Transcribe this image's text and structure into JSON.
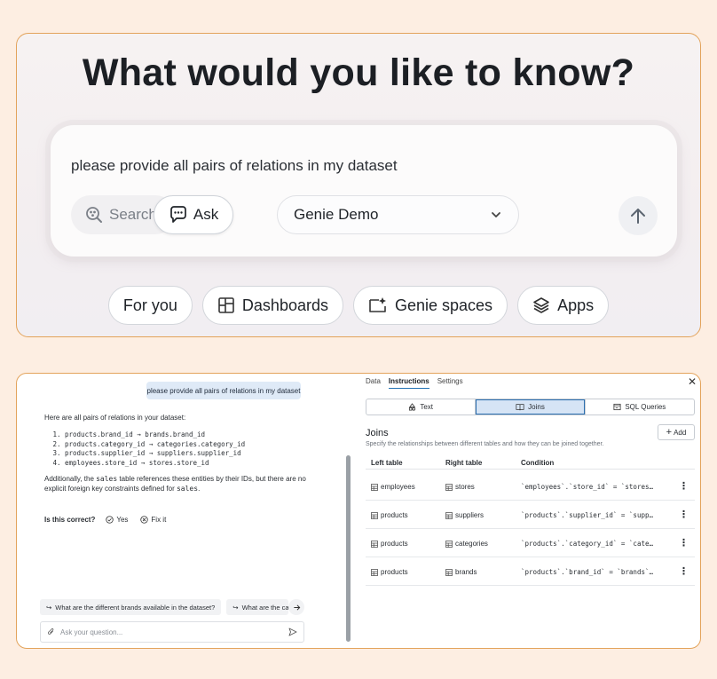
{
  "hero": {
    "title": "What would you like to know?"
  },
  "prompt": {
    "text": "please provide all pairs of relations in my dataset",
    "modes": {
      "search": "Search",
      "ask": "Ask"
    },
    "space_select": "Genie Demo"
  },
  "pills": [
    "For you",
    "Dashboards",
    "Genie spaces",
    "Apps"
  ],
  "chat": {
    "user_message": "please provide all pairs of relations in my dataset",
    "answer_intro": "Here are all pairs of relations in your dataset:",
    "relations": [
      "products.brand_id → brands.brand_id",
      "products.category_id → categories.category_id",
      "products.supplier_id → suppliers.supplier_id",
      "employees.store_id → stores.store_id"
    ],
    "answer_note_1": "Additionally, the ",
    "answer_note_code": "sales",
    "answer_note_2": " table references these entities by their IDs, but there are no explicit foreign key constraints defined for ",
    "answer_note_code2": "sales",
    "answer_note_3": ".",
    "feedback": {
      "label": "Is this correct?",
      "yes": "Yes",
      "fix": "Fix it"
    },
    "suggestions": [
      "What are the different brands available in the dataset?",
      "What are the categories"
    ],
    "input_placeholder": "Ask your question..."
  },
  "config": {
    "tabs": [
      "Data",
      "Instructions",
      "Settings"
    ],
    "active_tab": "Instructions",
    "segments": [
      "Text",
      "Joins",
      "SQL Queries"
    ],
    "active_segment": "Joins",
    "joins_title": "Joins",
    "joins_subtitle": "Specify the relationships between different tables and how they can be joined together.",
    "add_label": "Add",
    "columns": [
      "Left table",
      "Right table",
      "Condition"
    ],
    "rows": [
      {
        "left": "employees",
        "right": "stores",
        "condition": "`employees`.`store_id` = `stores`.`store_id`"
      },
      {
        "left": "products",
        "right": "suppliers",
        "condition": "`products`.`supplier_id` = `suppliers`.`supplier_id`"
      },
      {
        "left": "products",
        "right": "categories",
        "condition": "`products`.`category_id` = `categories`.`category_id`"
      },
      {
        "left": "products",
        "right": "brands",
        "condition": "`products`.`brand_id` = `brands`.`brand_id`"
      }
    ]
  },
  "colors": {
    "background": "#fdeee2",
    "panel_border": "#e3a35b",
    "accent": "#2272b4",
    "bubble": "#dfeaf7"
  }
}
